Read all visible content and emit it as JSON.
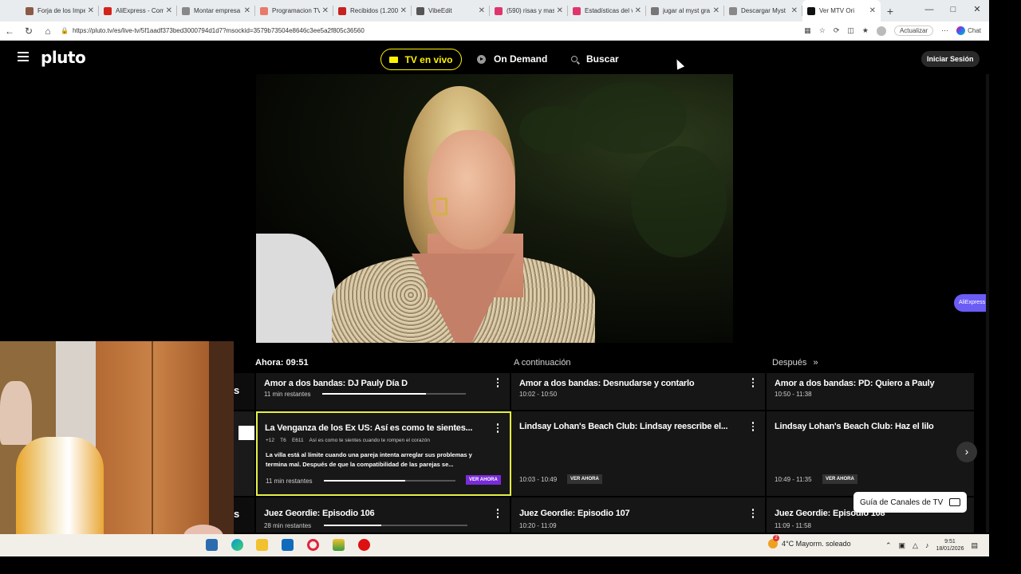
{
  "browser": {
    "tabs": [
      {
        "label": "Forja de los Impe",
        "color": "#8a5a44"
      },
      {
        "label": "AliExpress - Comp",
        "color": "#d4231b"
      },
      {
        "label": "Montar empresa",
        "color": "#888888"
      },
      {
        "label": "Programacion TV",
        "color": "#e87a6b"
      },
      {
        "label": "Recibidos (1.200)",
        "color": "#c5221f"
      },
      {
        "label": "VibeEdit",
        "color": "#555555"
      },
      {
        "label": "(590) risas y mas",
        "color": "#e0356c"
      },
      {
        "label": "Estadísticas del v",
        "color": "#e0356c"
      },
      {
        "label": "jugar al myst gra",
        "color": "#777777"
      },
      {
        "label": "Descargar Myst",
        "color": "#888888"
      },
      {
        "label": "Ver MTV Ori",
        "color": "#111111"
      }
    ],
    "new_tab": "+",
    "url": "https://pluto.tv/es/live-tv/5f1aadf373bed3000794d1d7?msockid=3579b73504e8646c3ee5a2f805c36560",
    "actualizar_label": "Actualizar",
    "chat_label": "Chat"
  },
  "pluto": {
    "logo": "pluto",
    "tv_en_vivo": "TV en vivo",
    "on_demand": "On Demand",
    "buscar": "Buscar",
    "iniciar_sesion": "Iniciar Sesión",
    "aliexpress_pill": "AliExpress"
  },
  "guide": {
    "header_now": "Ahora: 09:51",
    "header_next": "A continuación",
    "header_after": "Después",
    "rows": [
      {
        "channel_letter": "s",
        "now": {
          "title": "Amor a dos bandas: DJ Pauly Día D",
          "sub": "11 min restantes",
          "progress": 0.72
        },
        "next": {
          "title": "Amor a dos bandas: Desnudarse y contarlo",
          "time": "10:02 - 10:50"
        },
        "after": {
          "title": "Amor a dos bandas: PD: Quiero a Pauly",
          "time": "10:50 - 11:38"
        }
      },
      {
        "channel_letter": "",
        "now": {
          "title": "La Venganza de los Ex US: Así es como te sientes...",
          "rating": "+12",
          "season": "T6",
          "episode": "E611",
          "ep_title": "Así es como te sientes cuando te rompen el corazón",
          "desc_line1": "La villa está al límite cuando una pareja intenta arreglar sus problemas y",
          "desc_line2": "termina mal. Después de que la compatibilidad de las parejas se...",
          "sub": "11 min restantes",
          "progress": 0.62,
          "cta": "VER AHORA"
        },
        "next": {
          "title": "Lindsay Lohan's Beach Club: Lindsay reescribe el...",
          "time": "10:03 - 10:49",
          "cta": "VER AHORA"
        },
        "after": {
          "title": "Lindsay Lohan's Beach Club: Haz el lilo",
          "time": "10:49 - 11:35",
          "cta": "VER AHORA"
        }
      },
      {
        "channel_letter": "s",
        "now": {
          "title": "Juez Geordie: Episodio 106",
          "sub": "28 min restantes",
          "progress": 0.4
        },
        "next": {
          "title": "Juez Geordie: Episodio 107",
          "time": "10:20 - 11:09"
        },
        "after": {
          "title": "Juez Geordie: Episodio 108",
          "time": "11:09 - 11:58"
        }
      }
    ],
    "tooltip": "Guía de Canales de TV"
  },
  "taskbar": {
    "weather": "4°C  Mayorm. soleado",
    "weather_badge": "2",
    "time": "9:51",
    "date": "18/01/2026"
  }
}
